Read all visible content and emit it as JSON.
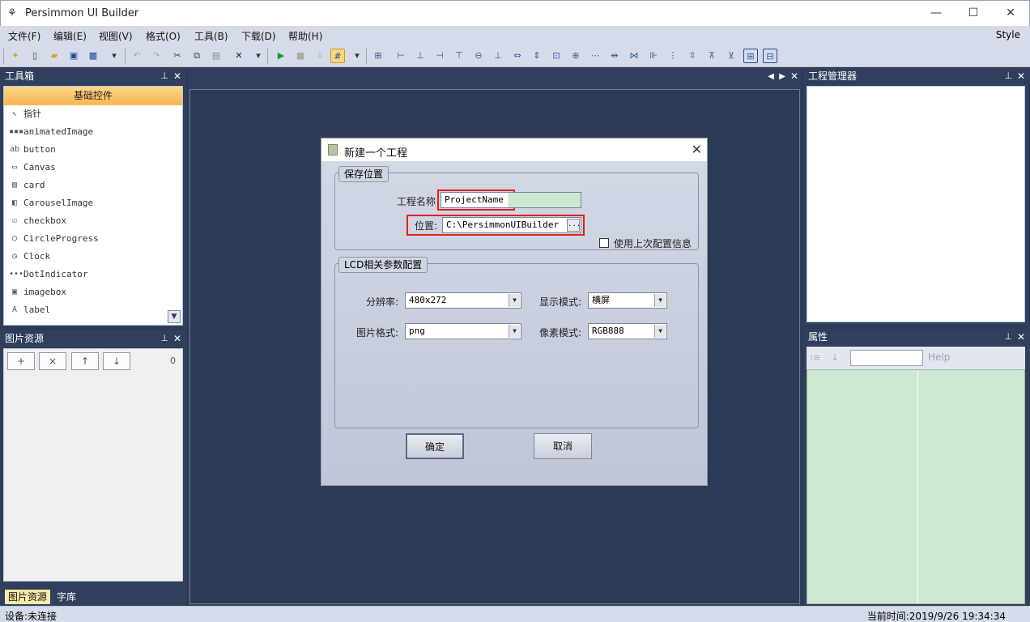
{
  "window": {
    "title": "Persimmon UI Builder",
    "minimize": "—",
    "maximize": "☐",
    "close": "✕"
  },
  "menu": [
    "文件(F)",
    "编辑(E)",
    "视图(V)",
    "格式(O)",
    "工具(B)",
    "下载(D)",
    "帮助(H)"
  ],
  "style_label": "Style",
  "toolbox": {
    "title": "工具箱",
    "tab": "基础控件",
    "items": [
      {
        "label": "指针",
        "icon": "pointer-icon",
        "glyph": "↖"
      },
      {
        "label": "animatedImage",
        "icon": "animated-image-icon",
        "glyph": "▪▪▪"
      },
      {
        "label": "button",
        "icon": "button-icon",
        "glyph": "ab"
      },
      {
        "label": "Canvas",
        "icon": "canvas-icon",
        "glyph": "▭"
      },
      {
        "label": "card",
        "icon": "card-icon",
        "glyph": "▤"
      },
      {
        "label": "CarouselImage",
        "icon": "carousel-icon",
        "glyph": "◧"
      },
      {
        "label": "checkbox",
        "icon": "checkbox-icon",
        "glyph": "☑"
      },
      {
        "label": "CircleProgress",
        "icon": "circle-progress-icon",
        "glyph": "◯"
      },
      {
        "label": "Clock",
        "icon": "clock-icon",
        "glyph": "◷"
      },
      {
        "label": "DotIndicator",
        "icon": "dot-indicator-icon",
        "glyph": "•••"
      },
      {
        "label": "imagebox",
        "icon": "imagebox-icon",
        "glyph": "▣"
      },
      {
        "label": "label",
        "icon": "label-icon",
        "glyph": "A"
      }
    ]
  },
  "image_resources": {
    "title": "图片资源",
    "buttons": [
      "+",
      "×",
      "↑",
      "↓"
    ],
    "count": "0",
    "tabs": [
      "图片资源",
      "字库"
    ]
  },
  "document": {
    "controls": [
      "◀",
      "▶",
      "✕"
    ]
  },
  "dialog": {
    "title": "新建一个工程",
    "save_group": "保存位置",
    "project_name_label": "工程名称",
    "project_name_value": "ProjectName",
    "location_label": "位置:",
    "location_value": "C:\\PersimmonUIBuilder",
    "browse": "...",
    "use_last_config": "使用上次配置信息",
    "lcd_group": "LCD相关参数配置",
    "resolution_label": "分辨率:",
    "resolution_value": "480x272",
    "display_mode_label": "显示模式:",
    "display_mode_value": "横屏",
    "image_format_label": "图片格式:",
    "image_format_value": "png",
    "pixel_mode_label": "像素模式:",
    "pixel_mode_value": "RGB888",
    "ok": "确定",
    "cancel": "取消"
  },
  "project_manager": {
    "title": "工程管理器"
  },
  "properties": {
    "title": "属性",
    "help": "Help"
  },
  "status": {
    "device": "设备:未连接",
    "time": "当前时间:2019/9/26 19:34:34"
  },
  "panel_icons": {
    "pin": "📌",
    "close": "✕"
  }
}
